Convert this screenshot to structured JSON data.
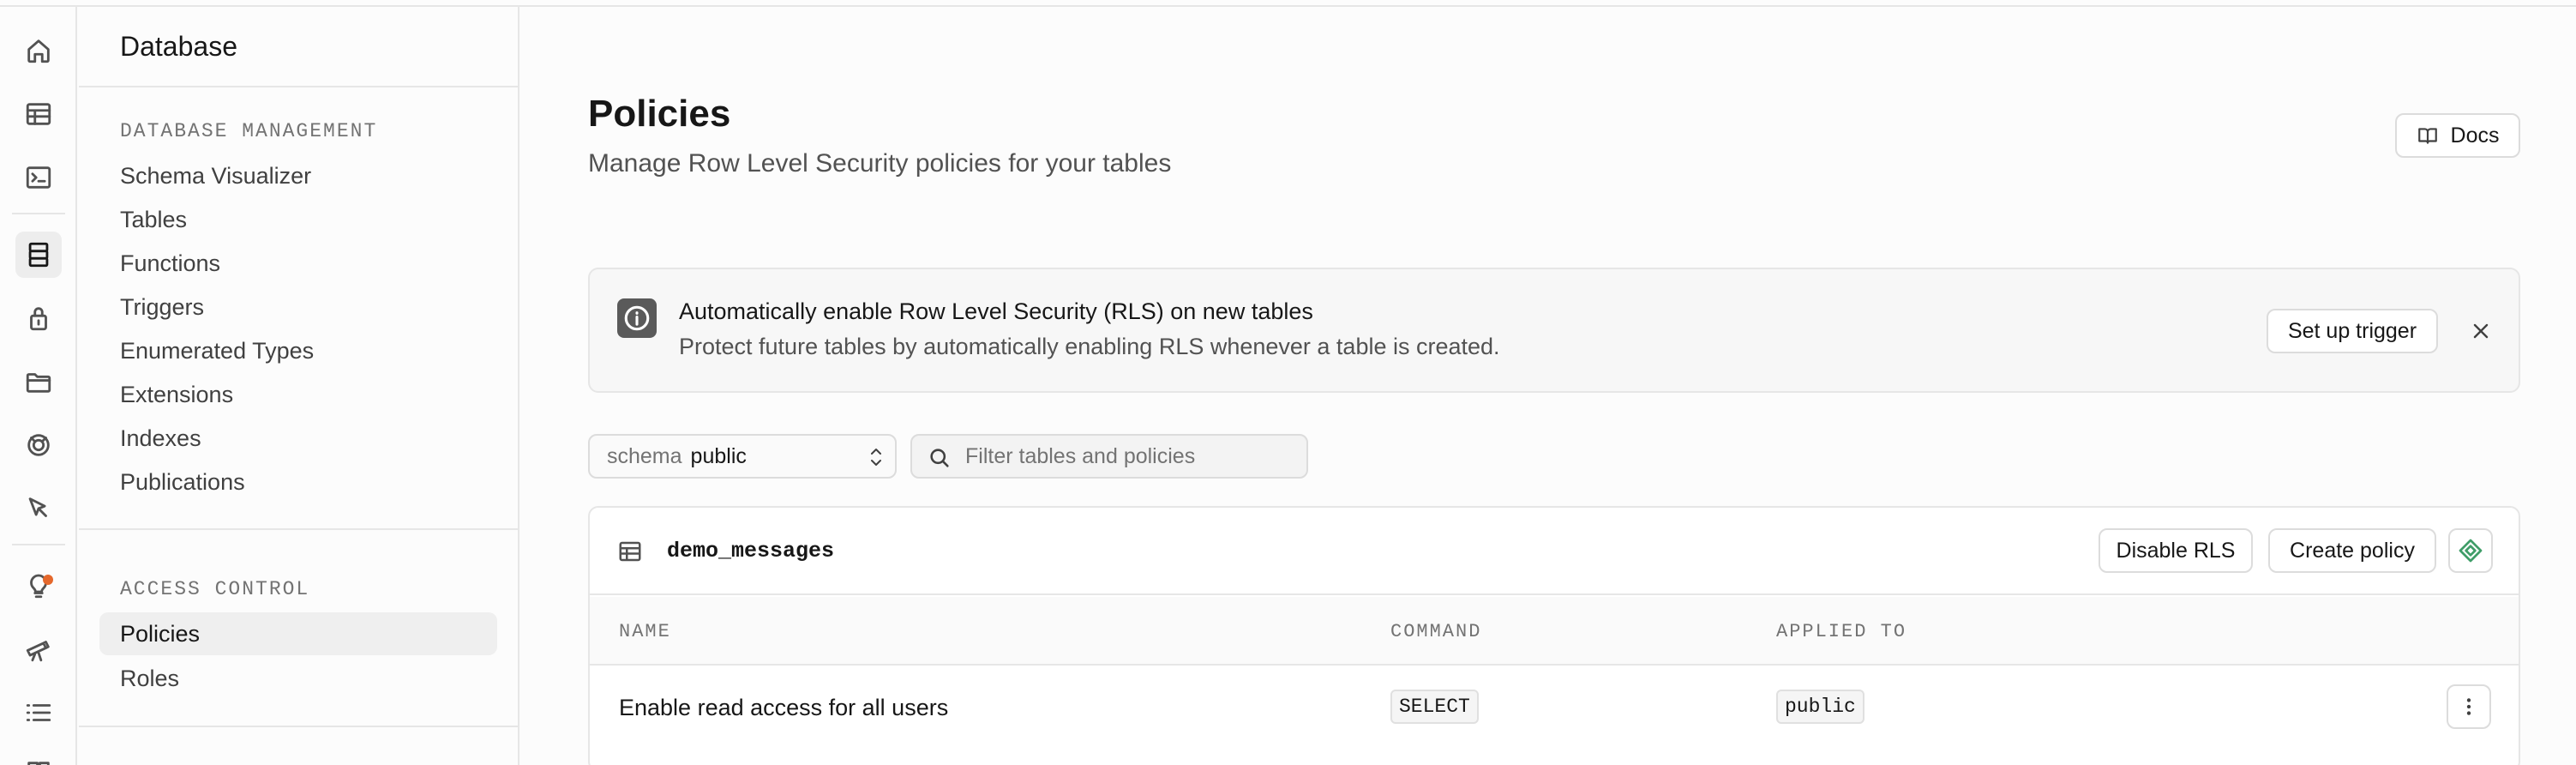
{
  "rail": {
    "items": [
      {
        "name": "home-icon"
      },
      {
        "name": "table-editor-icon"
      },
      {
        "name": "sql-editor-icon"
      },
      {
        "name": "database-icon",
        "active": true
      },
      {
        "name": "auth-lock-icon"
      },
      {
        "name": "storage-folder-icon"
      },
      {
        "name": "realtime-icon"
      },
      {
        "name": "edge-functions-cursor-icon"
      },
      {
        "name": "advisors-lightbulb-icon",
        "badge": true
      },
      {
        "name": "observability-telescope-icon"
      },
      {
        "name": "logs-list-icon"
      }
    ],
    "badge_color": "#e5682c"
  },
  "sidebar": {
    "title": "Database",
    "sections": [
      {
        "label": "DATABASE MANAGEMENT",
        "items": [
          "Schema Visualizer",
          "Tables",
          "Functions",
          "Triggers",
          "Enumerated Types",
          "Extensions",
          "Indexes",
          "Publications"
        ]
      },
      {
        "label": "ACCESS CONTROL",
        "items": [
          "Policies",
          "Roles"
        ]
      }
    ],
    "active_item": "Policies"
  },
  "header": {
    "title": "Policies",
    "subtitle": "Manage Row Level Security policies for your tables",
    "docs_label": "Docs"
  },
  "banner": {
    "title": "Automatically enable Row Level Security (RLS) on new tables",
    "description": "Protect future tables by automatically enabling RLS whenever a table is created.",
    "action_label": "Set up trigger"
  },
  "filters": {
    "schema_label": "schema",
    "schema_value": "public",
    "search_placeholder": "Filter tables and policies"
  },
  "table_card": {
    "table_name": "demo_messages",
    "disable_rls_label": "Disable RLS",
    "create_policy_label": "Create policy",
    "columns": [
      "NAME",
      "COMMAND",
      "APPLIED TO"
    ],
    "rows": [
      {
        "name": "Enable read access for all users",
        "command": "SELECT",
        "applied_to": "public"
      }
    ]
  },
  "colors": {
    "accent_green": "#3f9d68",
    "text_primary": "#171717",
    "text_muted": "#737373",
    "border": "#e6e6e6"
  }
}
